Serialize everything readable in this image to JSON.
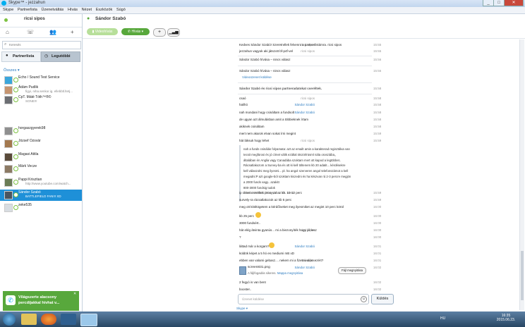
{
  "window": {
    "title": "Skype™ - jezzahun",
    "buttons": [
      "_",
      "□",
      "✕"
    ]
  },
  "menu": [
    "Skype",
    "Partnerlista",
    "Üzenetváltás",
    "Hívás",
    "Nézet",
    "Eszközök",
    "Súgó"
  ],
  "profile": {
    "name": "ricsi sipos"
  },
  "search": {
    "placeholder": "Keresés"
  },
  "tabs": {
    "contacts": "Partnerlista",
    "recent": "Legutóbbi"
  },
  "filter": "Összes",
  "contacts": [
    {
      "name": "Echo / Sound Test Service",
      "mood": ""
    },
    {
      "name": "Ádám Pudlik",
      "mood": "figyi, niha.senkor.ig. ellebbtl.ltetj..."
    },
    {
      "name": "CpT. Máté Tóth™®©",
      "mood": "SONE!!!"
    },
    {
      "name": "horgaszgyerek98",
      "mood": ""
    },
    {
      "name": "József Ozsvár",
      "mood": ""
    },
    {
      "name": "Magasi Attila",
      "mood": ""
    },
    {
      "name": "Márk Vecze",
      "mood": ""
    },
    {
      "name": "Pappi Krisztian",
      "mood": "http://www.youtube.com/watch..."
    },
    {
      "name": "Sándor Szabó",
      "mood": "BATTLEFIELD FAN!!! XD"
    },
    {
      "name": "zeke535",
      "mood": ""
    }
  ],
  "ad": {
    "line1": "Világszerte alacsony",
    "line2": "percdíjakkal hívhat v..."
  },
  "chat": {
    "contact": "Sándor Szabó",
    "buttons": {
      "video": "Videohívás",
      "call": "Hívás",
      "add": "+"
    },
    "messages": [
      {
        "sender": "ricsi sipos",
        "text": "Kedves Sándor Szabó! Szeretnélek felvenni a partnerlistámra. ricsi sipos",
        "time": "15:55",
        "me": true
      },
      {
        "sender": "ricsi sipos",
        "text": "jezzahun vagyok aki játszott bf-p4f-vel",
        "time": "15:55",
        "me": true
      },
      {
        "sender": "",
        "text": "Sándor Szabó hívása – nincs válasz",
        "time": "15:56",
        "me": false
      },
      {
        "sender": "",
        "text": "Sándor Szabó hívása – nincs válasz",
        "time": "15:56",
        "me": false
      },
      {
        "sender": "",
        "text": "Videoüzenet küldése",
        "time": "",
        "me": false
      },
      {
        "sender": "",
        "text": "Sándor Szabó és ricsi sipos partneradatokat cseréltek.",
        "time": "15:58",
        "me": false
      },
      {
        "sender": "ricsi sipos",
        "text": "csaó",
        "time": "15:58",
        "me": true
      },
      {
        "sender": "Sándor Szabó",
        "text": "halihó",
        "time": "15:58",
        "me": false
      },
      {
        "sender": "Sándor Szabó",
        "text": "nah mondani hogy csináltam a fundsolt",
        "time": "15:58",
        "me": false
      },
      {
        "sender": "",
        "text": "de ugyan azt álmulásban amit a többieknek írtam",
        "time": "15:58",
        "me": false
      },
      {
        "sender": "",
        "text": "akiknek csináltam",
        "time": "15:58",
        "me": false
      },
      {
        "sender": "",
        "text": "mert nem akarok elvan sokat írni megint",
        "time": "15:59",
        "me": false
      },
      {
        "sender": "ricsi sipos",
        "text": "hát láksuk hogy lehet",
        "time": "15:59",
        "me": true
      }
    ],
    "quote": {
      "lines": [
        "nah a funds csinálás folyamata: azt az emailt amin a karakterad regisztálva van",
        "tecsit megfürosi és jó címet válik ezáltal ötszörlrüsml nála orosziába,,",
        "általában én Anglia vagy Canadába szoktam mert ott kapod a legtöbbet..",
        "Rácsatlakozom a Survey-ba és ott ki kell töltenem kb 20 adatit... kérdésekre",
        "kell válaszolni meg ilyesmi... pl. ha angol szerveren angol telefonszámot a kell",
        "megadni:P azt google-ból szoktam kiszedni és ha készvan rá 2-3 percre megjön",
        "a 2000 funds vagy.. azakitt",
        "800-3000 fundsig tudok"
      ],
      "footer": "Sándor Szabó, 2015. június 18. 15:32"
    },
    "messages2": [
      {
        "sender": "",
        "text": "ip címet cseréltek proxyval az kb. 10-12 perc",
        "time": "15:59",
        "me": false
      },
      {
        "sender": "",
        "text": "survely-ra rácsatlakozok az kb 5 perc",
        "time": "15:59",
        "me": false
      },
      {
        "sender": "",
        "text": "meg ott kitöltögetem a kérdőíveket meg ilyesmiket az megint 10 perc körül",
        "time": "16:00",
        "me": false
      },
      {
        "sender": "",
        "text": "kb 25 perc",
        "time": "16:00",
        "me": false
      },
      {
        "sender": "",
        "text": "3000 fundsért..",
        "time": "16:00",
        "me": false
      },
      {
        "sender": "ricsi sipos",
        "text": "hát elég átvinta gyanús... mi a biezonyíték hogy jól lesz",
        "time": "16:00",
        "me": true
      },
      {
        "sender": "",
        "text": "?",
        "time": "16:00",
        "me": false
      },
      {
        "sender": "Sándor Szabó",
        "text": "láttad már a korgam?",
        "time": "16:01",
        "me": false
      },
      {
        "sender": "",
        "text": "küldök képet a 5 hó es mediumi mB xD",
        "time": "16:01",
        "me": false
      },
      {
        "sender": "ricsi sipos",
        "text": "ebben van valami gebasz.... nekem mi a fizetnivalóm ezért?",
        "time": "16:01",
        "me": true
      },
      {
        "sender": "Sándor Szabó",
        "text": "screen831.png",
        "time": "16:02",
        "me": false
      },
      {
        "sender": "",
        "text": "2 fegyó is van bent",
        "time": "16:02",
        "me": false
      },
      {
        "sender": "",
        "text": "booster..",
        "time": "16:02",
        "me": false
      }
    ],
    "file": {
      "name": "screen831.png",
      "desc": "A fájlfogadás sikeres.",
      "link": "Mappa megnyitása",
      "button": "Fájl megnyitása"
    },
    "input_placeholder": "Üzenet küldése",
    "send_label": "Küldés",
    "footer_label": "Skype"
  },
  "taskbar": {
    "lang": "HU",
    "time": "16:35",
    "date": "2015.06.23."
  }
}
